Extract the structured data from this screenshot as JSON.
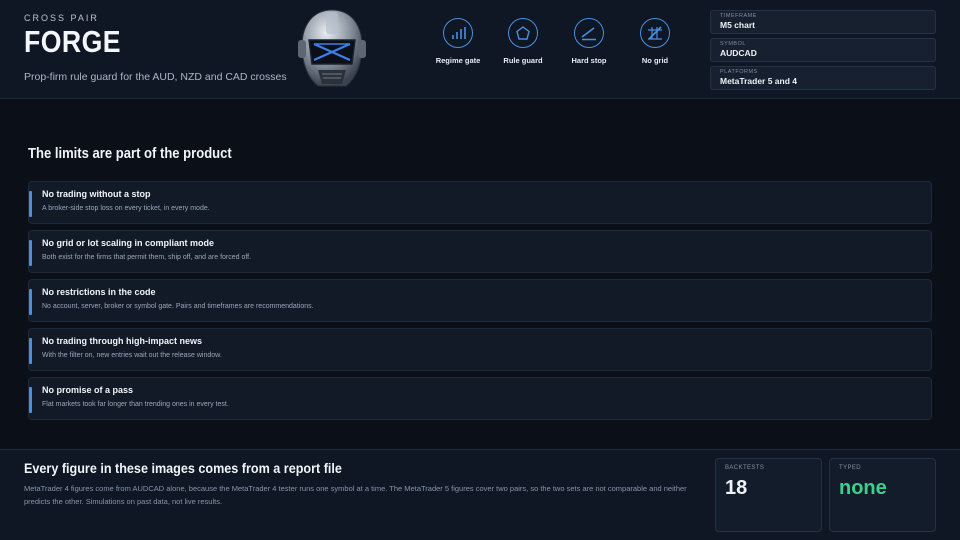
{
  "header": {
    "eyebrow": "CROSS PAIR",
    "brand": "FORGE",
    "tagline": "Prop-firm rule guard for the AUD, NZD and CAD crosses",
    "features": [
      {
        "label": "Regime gate",
        "icon": "bar-chart-icon"
      },
      {
        "label": "Rule guard",
        "icon": "pentagon-shield-icon"
      },
      {
        "label": "Hard stop",
        "icon": "stop-line-icon"
      },
      {
        "label": "No grid",
        "icon": "no-grid-icon"
      }
    ],
    "meta": [
      {
        "key": "TIMEFRAME",
        "value": "M5 chart"
      },
      {
        "key": "SYMBOL",
        "value": "AUDCAD"
      },
      {
        "key": "PLATFORMS",
        "value": "MetaTrader 5 and 4"
      }
    ]
  },
  "main": {
    "title": "The limits are part of the product",
    "limits": [
      {
        "title": "No trading without a stop",
        "desc": "A broker-side stop loss on every ticket, in every mode."
      },
      {
        "title": "No grid or lot scaling in compliant mode",
        "desc": "Both exist for the firms that permit them, ship off, and are forced off."
      },
      {
        "title": "No restrictions in the code",
        "desc": "No account, server, broker or symbol gate. Pairs and timeframes are recommendations."
      },
      {
        "title": "No trading through high-impact news",
        "desc": "With the filter on, new entries wait out the release window."
      },
      {
        "title": "No promise of a pass",
        "desc": "Flat markets took far longer than trending ones in every test."
      }
    ]
  },
  "footer": {
    "title": "Every figure in these images comes from a report file",
    "text": "MetaTrader 4 figures come from AUDCAD alone, because the MetaTrader 4 tester runs one symbol at a time. The MetaTrader 5 figures cover two pairs, so the two sets are not comparable and neither predicts the other. Simulations on past data, not live results.",
    "stats": [
      {
        "key": "BACKTESTS",
        "value": "18",
        "color": "#eef2f7"
      },
      {
        "key": "TYPED",
        "value": "none",
        "color": "#3ecf8e"
      }
    ]
  },
  "colors": {
    "accent": "#4a8fe0",
    "positive": "#3ecf8e",
    "background": "#0b1018"
  }
}
